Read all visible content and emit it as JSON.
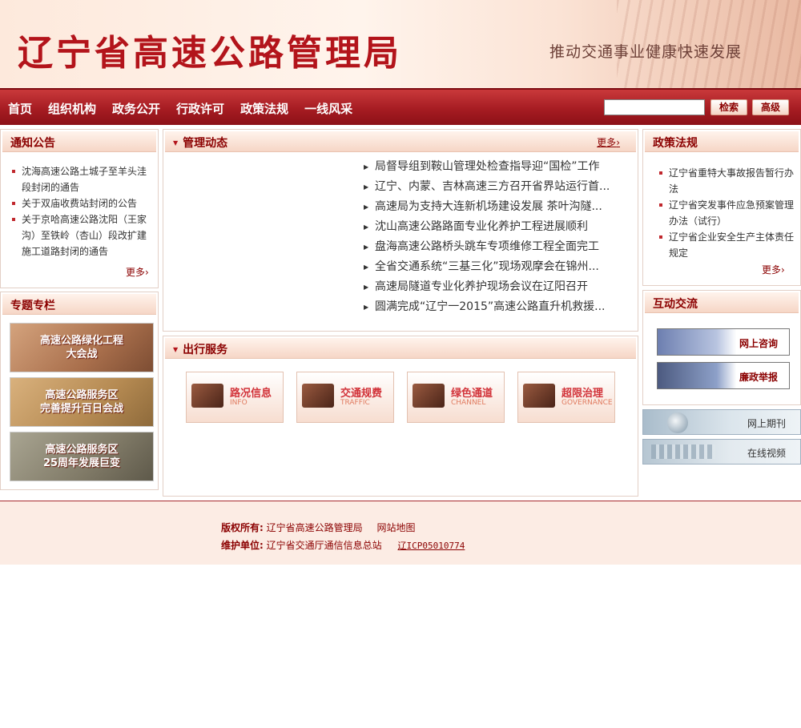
{
  "header": {
    "title": "辽宁省高速公路管理局",
    "slogan": "推动交通事业健康快速发展"
  },
  "nav": {
    "items": [
      "首页",
      "组织机构",
      "政务公开",
      "行政许可",
      "政策法规",
      "一线风采"
    ],
    "search_value": "",
    "search_button": "检索",
    "advanced_button": "高级"
  },
  "notice": {
    "title": "通知公告",
    "items": [
      "沈海高速公路土城子至羊头洼段封闭的通告",
      "关于双庙收费站封闭的公告",
      "关于京哈高速公路沈阳（王家沟）至铁岭（杏山）段改扩建施工道路封闭的通告"
    ],
    "more": "更多"
  },
  "topics": {
    "title": "专题专栏",
    "items": [
      "高速公路绿化工程\n大会战",
      "高速公路服务区\n完善提升百日会战",
      "高速公路服务区\n25周年发展巨变"
    ]
  },
  "management": {
    "title": "管理动态",
    "more": "更多",
    "items": [
      "局督导组到鞍山管理处检查指导迎“国检”工作",
      "辽宁、内蒙、吉林高速三方召开省界站运行首...",
      "高速局为支持大连新机场建设发展 茶叶沟隧...",
      "沈山高速公路路面专业化养护工程进展顺利",
      "盘海高速公路桥头跳车专项维修工程全面完工",
      "全省交通系统“三基三化”现场观摩会在锦州...",
      "高速局隧道专业化养护现场会议在辽阳召开",
      "圆满完成“辽宁一2015”高速公路直升机救援..."
    ]
  },
  "service": {
    "title": "出行服务",
    "items": [
      {
        "cn": "路况信息",
        "en": "INFO"
      },
      {
        "cn": "交通规费",
        "en": "TRAFFIC"
      },
      {
        "cn": "绿色通道",
        "en": "CHANNEL"
      },
      {
        "cn": "超限治理",
        "en": "GOVERNANCE"
      }
    ]
  },
  "policy": {
    "title": "政策法规",
    "items": [
      "辽宁省重特大事故报告暂行办法",
      "辽宁省突发事件应急预案管理办法（试行）",
      "辽宁省企业安全生产主体责任规定"
    ],
    "more": "更多"
  },
  "interaction": {
    "title": "互动交流",
    "consult": "网上咨询",
    "report": "廉政举报",
    "journal": "网上期刊",
    "video": "在线视频"
  },
  "footer": {
    "copyright_label": "版权所有:",
    "copyright_value": "辽宁省高速公路管理局",
    "sitemap": "网站地图",
    "maintainer_label": "维护单位:",
    "maintainer_value": "辽宁省交通厅通信信息总站",
    "icp": "辽ICP05010774"
  }
}
